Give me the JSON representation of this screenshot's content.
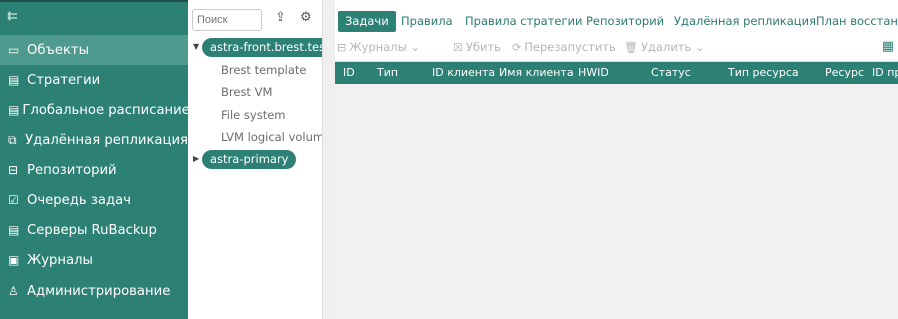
{
  "sidebar": {
    "collapse_label": "⇇",
    "items": [
      {
        "label": "Объекты",
        "icon": "monitor-icon",
        "glyph": "▭",
        "active": true
      },
      {
        "label": "Стратегии",
        "icon": "document-icon",
        "glyph": "▤"
      },
      {
        "label": "Глобальное расписание",
        "icon": "schedule-icon",
        "glyph": "▤"
      },
      {
        "label": "Удалённая репликация",
        "icon": "replication-icon",
        "glyph": "⧉"
      },
      {
        "label": "Репозиторий",
        "icon": "repository-icon",
        "glyph": "⊟"
      },
      {
        "label": "Очередь задач",
        "icon": "task-queue-icon",
        "glyph": "☑"
      },
      {
        "label": "Серверы RuBackup",
        "icon": "server-icon",
        "glyph": "▤"
      },
      {
        "label": "Журналы",
        "icon": "log-icon",
        "glyph": "▣"
      },
      {
        "label": "Администрирование",
        "icon": "admin-icon",
        "glyph": "♙"
      }
    ]
  },
  "tree": {
    "search_placeholder": "Поиск",
    "upload_glyph": "⇪",
    "settings_glyph": "⚙",
    "nodes": [
      {
        "label": "astra-front.brest.test",
        "expanded": true,
        "children": [
          "Brest template",
          "Brest VM",
          "File system",
          "LVM logical volume"
        ]
      },
      {
        "label": "astra-primary",
        "expanded": false,
        "children": []
      }
    ]
  },
  "tabs": [
    "Задачи",
    "Правила",
    "Правила стратегии",
    "Репозиторий",
    "Удалённая репликация",
    "План восстановл"
  ],
  "toolbar": {
    "logs_label": "Журналы",
    "kill_label": "Убить",
    "restart_label": "Перезапустить",
    "delete_label": "Удалить",
    "grid_glyph": "▦"
  },
  "table": {
    "columns": [
      "ID",
      "Тип",
      "ID клиента",
      "Имя клиента",
      "HWID",
      "Статус",
      "Тип ресурса",
      "Ресурс",
      "ID пр"
    ]
  },
  "colors": {
    "accent": "#2d8174",
    "active_nav": "#4f9a8e",
    "tab_text": "#2d7a6f",
    "disabled": "#b6b6b6"
  }
}
